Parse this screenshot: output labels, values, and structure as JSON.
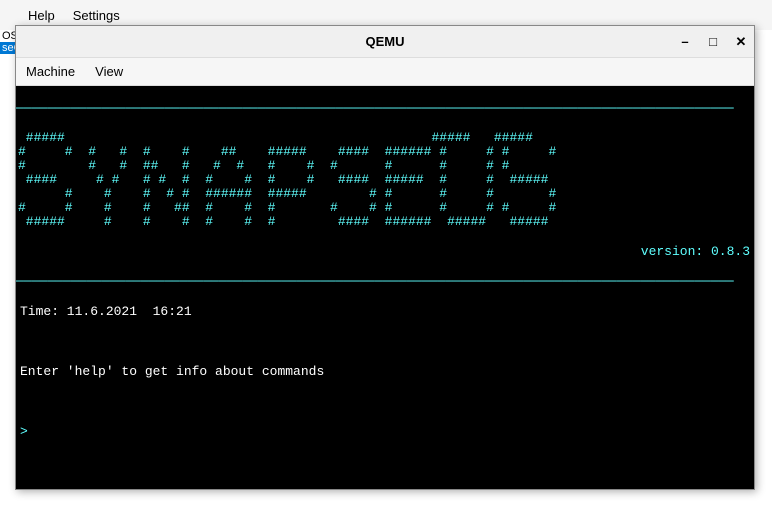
{
  "background": {
    "menu": {
      "help": "Help",
      "settings": "Settings"
    },
    "tab1": "OS.ini",
    "tab2": "seOS"
  },
  "window": {
    "title": "QEMU",
    "controls": {
      "min": "–",
      "max": "□",
      "close": "✕"
    },
    "menu": {
      "machine": "Machine",
      "view": "View"
    }
  },
  "terminal": {
    "hr": "────────────────────────────────────────────────────────────────────────────────────────────",
    "ascii": " #####                                               #####   #####\n#     #  #   #  #    #    ##    #####    ####  ###### #     # #     #\n#        #   #  ##   #   #  #   #    #  #      #      #     # #\n ####     # #   # #  #  #    #  #    #   ####  #####  #     #  #####\n      #    #    #  # #  ######  #####        # #      #     #       #\n#     #    #    #   ##  #    #  #       #    # #      #     # #     #\n #####     #    #    #  #    #  #        ####  ######  #####   #####",
    "version_label": "version: 0.8.3",
    "time_label": "Time: 11.6.2021  16:21",
    "help_label": "Enter 'help' to get info about commands",
    "prompt": ">"
  }
}
